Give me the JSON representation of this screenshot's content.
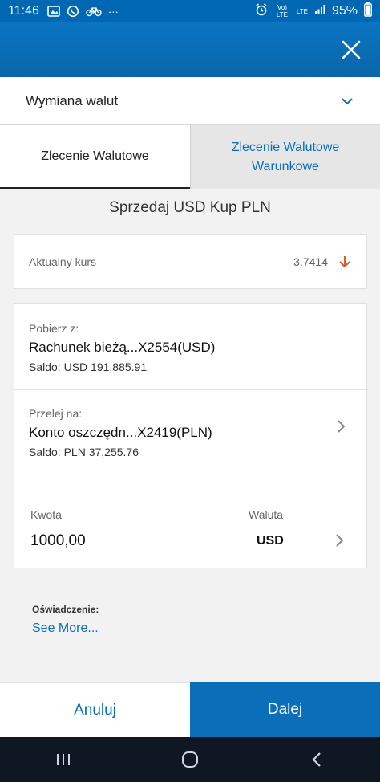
{
  "status_bar": {
    "time": "11:46",
    "left_icons": [
      "image-icon",
      "whatsapp-icon",
      "bike-icon",
      "more-icon"
    ],
    "more_glyph": "···",
    "right_labels": [
      "Vo) LTE",
      "LTE"
    ],
    "battery": "95%"
  },
  "header": {
    "close_icon": "close-icon"
  },
  "dropdown": {
    "label": "Wymiana walut"
  },
  "tabs": [
    {
      "label": "Zlecenie Walutowe",
      "active": true
    },
    {
      "label": "Zlecenie Walutowe Warunkowe",
      "active": false
    }
  ],
  "main": {
    "title": "Sprzedaj USD Kup PLN",
    "rate": {
      "label": "Aktualny kurs",
      "value": "3.7414",
      "trend_icon": "arrow-down-icon",
      "trend_color": "#e05a2b"
    },
    "from_account": {
      "label": "Pobierz z:",
      "name": "Rachunek bieżą...X2554(USD)",
      "balance": "Saldo: USD 191,885.91"
    },
    "to_account": {
      "label": "Przelej na:",
      "name": "Konto oszczędn...X2419(PLN)",
      "balance": "Saldo: PLN 37,255.76"
    },
    "amount": {
      "label": "Kwota",
      "value": "1000,00",
      "currency_label": "Waluta",
      "currency_value": "USD"
    },
    "declaration": {
      "label": "Oświadczenie:",
      "link": "See More..."
    }
  },
  "actions": {
    "cancel": "Anuluj",
    "next": "Dalej"
  },
  "colors": {
    "brand_blue": "#0a6fb8",
    "header_blue": "#0a70bb",
    "nav_bg": "#0e1722"
  }
}
